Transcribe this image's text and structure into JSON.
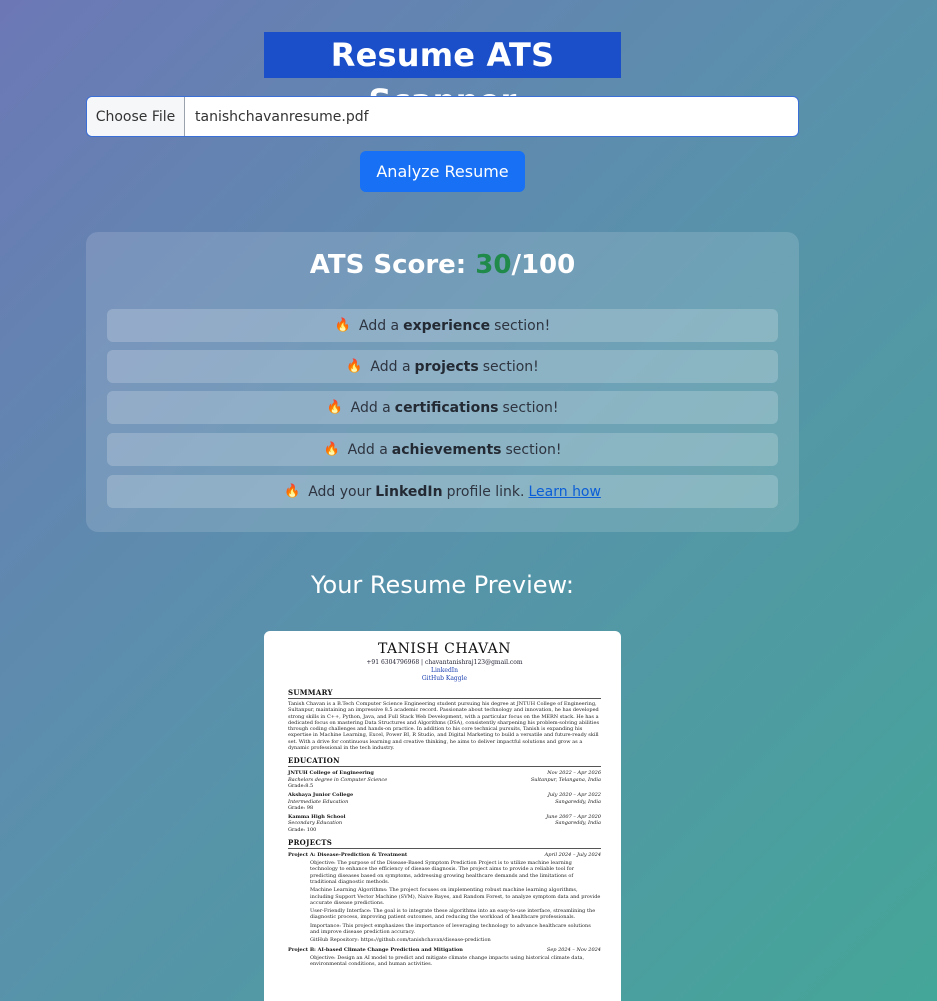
{
  "header": {
    "title": "Resume ATS Scanner"
  },
  "upload": {
    "choose_label": "Choose File",
    "file_name": "tanishchavanresume.pdf"
  },
  "analyze_label": "Analyze Resume",
  "score": {
    "label": "ATS Score:",
    "value": "30",
    "max": "/100"
  },
  "tips": [
    {
      "pre": "Add a",
      "key": "experience",
      "post": "section!"
    },
    {
      "pre": "Add a",
      "key": "projects",
      "post": "section!"
    },
    {
      "pre": "Add a",
      "key": "certifications",
      "post": "section!"
    },
    {
      "pre": "Add a",
      "key": "achievements",
      "post": "section!"
    },
    {
      "pre": "Add your",
      "key": "LinkedIn",
      "post": "profile link.",
      "link": "Learn how"
    }
  ],
  "tip_icon": "flame-icon",
  "preview_title": "Your Resume Preview:",
  "resume": {
    "name": "TANISH CHAVAN",
    "contact_line": "+91 6304796968 | chavantanishraj123@gmail.com",
    "links": [
      "LinkedIn",
      "GitHub",
      "Kaggle"
    ],
    "summary_heading": "SUMMARY",
    "summary": "Tanish Chavan is a B.Tech Computer Science Engineering student pursuing his degree at JNTUH College of Engineering, Sultanpur, maintaining an impressive 8.5 academic record. Passionate about technology and innovation, he has developed strong skills in C++, Python, Java, and Full Stack Web Development, with a particular focus on the MERN stack. He has a dedicated focus on mastering Data Structures and Algorithms (DSA), consistently sharpening his problem-solving abilities through coding challenges and hands-on practice. In addition to his core technical pursuits, Tanish is expanding his expertise in Machine Learning, Excel, Power BI, R Studio, and Digital Marketing to build a versatile and future-ready skill set. With a drive for continuous learning and creative thinking, he aims to deliver impactful solutions and grow as a dynamic professional in the tech industry.",
    "education_heading": "EDUCATION",
    "education": [
      {
        "school": "JNTUH College of Engineering",
        "degree": "Bachelors degree in Computer Science",
        "grade": "Grade:8.5",
        "dates": "Nov 2022 – Apr 2026",
        "place": "Sultanpur, Telangana, India"
      },
      {
        "school": "Akshaya Junior College",
        "degree": "Intermediate Education",
        "grade": "Grade: 98",
        "dates": "July 2020 – Apr 2022",
        "place": "Sangareddy, India"
      },
      {
        "school": "Kamma High School",
        "degree": "Secondary Education",
        "grade": "Grade: 100",
        "dates": "June 2007 – Apr 2020",
        "place": "Sangareddy, India"
      }
    ],
    "projects_heading": "PROJECTS",
    "projects": [
      {
        "title": "Project A: Disease-Prediction & Treatment",
        "dates": "April 2024 – July 2024",
        "bullets": [
          "Objective: The purpose of the Disease-Based Symptom Prediction Project is to utilize machine learning technology to enhance the efficiency of disease diagnosis. The project aims to provide a reliable tool for predicting diseases based on symptoms, addressing growing healthcare demands and the limitations of traditional diagnostic methods.",
          "Machine Learning Algorithms: The project focuses on implementing robust machine learning algorithms, including Support Vector Machine (SVM), Naive Bayes, and Random Forest, to analyze symptom data and provide accurate disease predictions.",
          "User-Friendly Interface: The goal is to integrate these algorithms into an easy-to-use interface, streamlining the diagnostic process, improving patient outcomes, and reducing the workload of healthcare professionals.",
          "Importance: This project emphasizes the importance of leveraging technology to advance healthcare solutions and improve disease prediction accuracy.",
          "GitHub Repository: https://github.com/tanishchavan/disease-prediction"
        ]
      },
      {
        "title": "Project B: AI-based Climate Change Prediction and Mitigation",
        "dates": "Sep 2024 – Nov 2024",
        "bullets": [
          "Objective: Design an AI model to predict and mitigate climate change impacts using historical climate data, environmental conditions, and human activities."
        ]
      }
    ]
  }
}
